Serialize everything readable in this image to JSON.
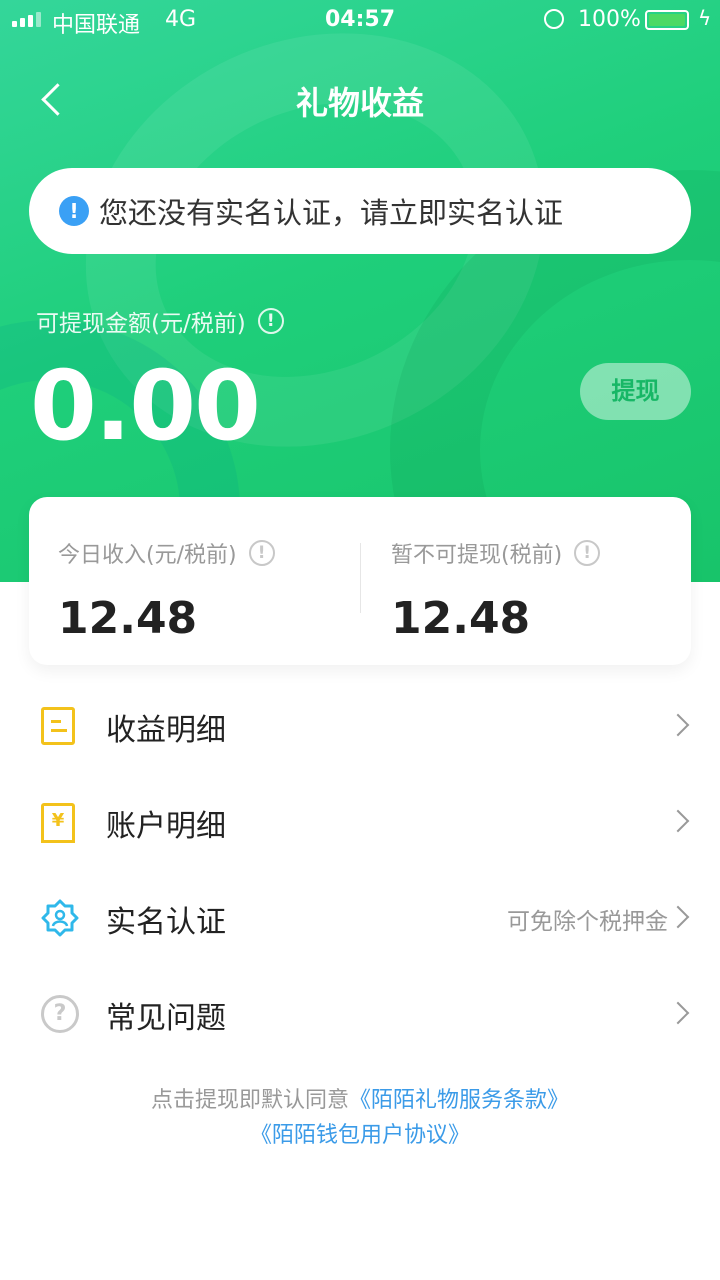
{
  "status_bar": {
    "carrier": "中国联通",
    "network": "4G",
    "time": "04:57",
    "battery": "100%",
    "battery_color": "#4cd964"
  },
  "header": {
    "title": "礼物收益",
    "back_icon": "chevron-left-icon"
  },
  "notice": {
    "icon": "exclamation-icon",
    "text": "您还没有实名认证，请立即实名认证"
  },
  "balance": {
    "label": "可提现金额(元/税前)",
    "amount": "0.00",
    "withdraw_label": "提现"
  },
  "stats": [
    {
      "label": "今日收入(元/税前)",
      "value": "12.48"
    },
    {
      "label": "暂不可提现(税前)",
      "value": "12.48"
    }
  ],
  "menu": [
    {
      "label": "收益明细",
      "hint": "",
      "icon": "document-icon"
    },
    {
      "label": "账户明细",
      "hint": "",
      "icon": "yen-bookmark-icon"
    },
    {
      "label": "实名认证",
      "hint": "可免除个税押金",
      "icon": "verified-user-icon"
    },
    {
      "label": "常见问题",
      "hint": "",
      "icon": "question-icon"
    }
  ],
  "footer": {
    "prefix": "点击提现即默认同意",
    "link1": "《陌陌礼物服务条款》",
    "link2": "《陌陌钱包用户协议》"
  },
  "colors": {
    "brand_green": "#1fcf7b",
    "link_blue": "#3b9be8",
    "accent_yellow": "#f3c21b",
    "accent_cyan": "#2fb8ea"
  }
}
